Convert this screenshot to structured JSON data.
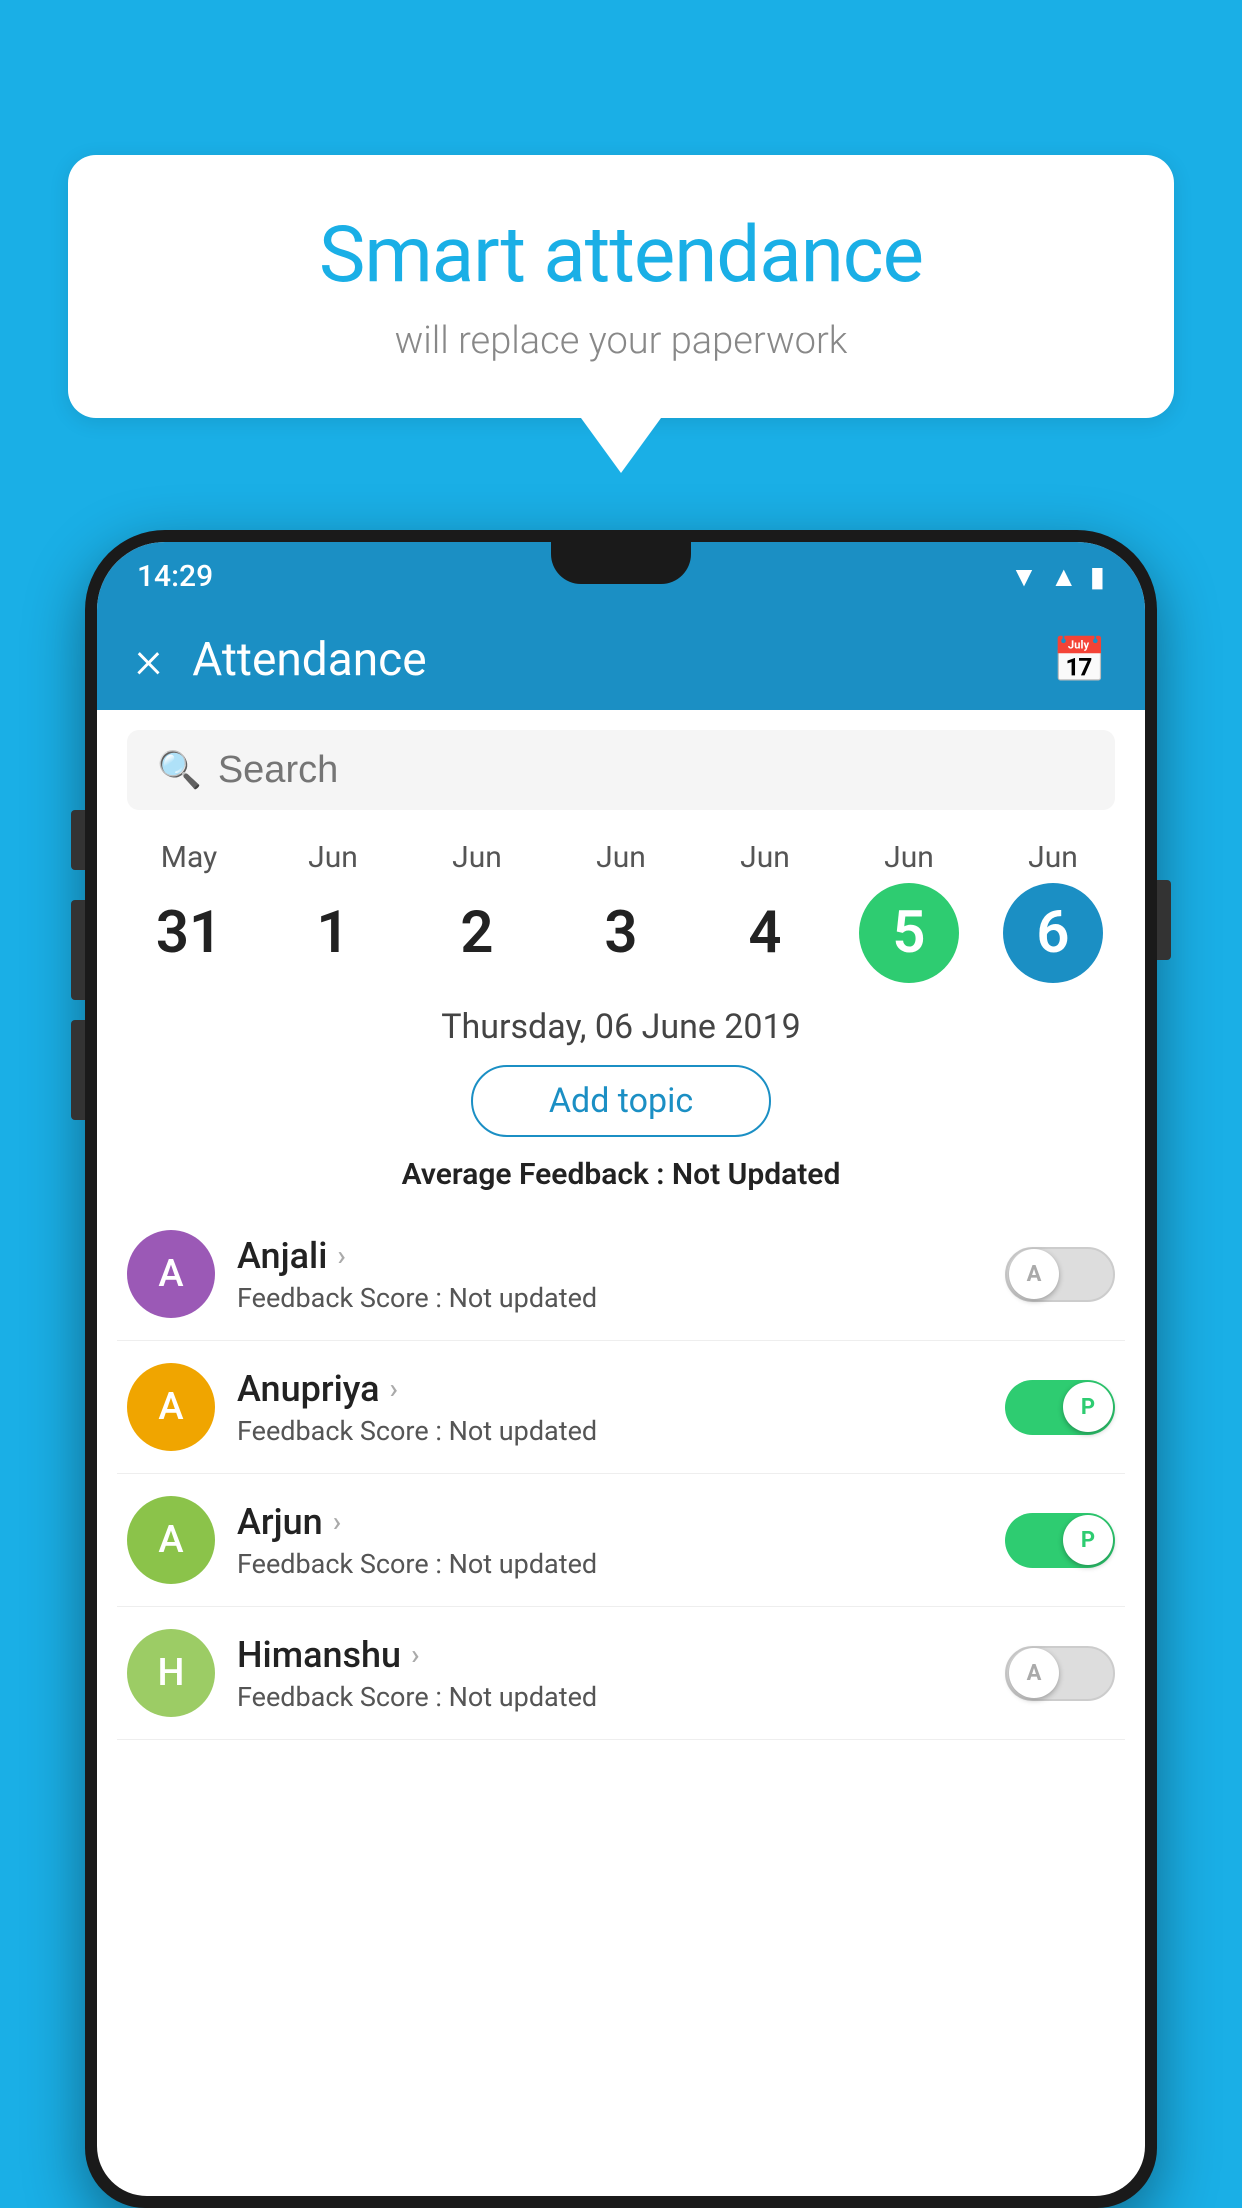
{
  "bubble": {
    "title": "Smart attendance",
    "subtitle": "will replace your paperwork"
  },
  "statusBar": {
    "time": "14:29"
  },
  "appBar": {
    "title": "Attendance",
    "closeLabel": "×"
  },
  "search": {
    "placeholder": "Search"
  },
  "calendar": {
    "days": [
      {
        "month": "May",
        "date": "31",
        "state": "normal"
      },
      {
        "month": "Jun",
        "date": "1",
        "state": "normal"
      },
      {
        "month": "Jun",
        "date": "2",
        "state": "normal"
      },
      {
        "month": "Jun",
        "date": "3",
        "state": "normal"
      },
      {
        "month": "Jun",
        "date": "4",
        "state": "normal"
      },
      {
        "month": "Jun",
        "date": "5",
        "state": "today"
      },
      {
        "month": "Jun",
        "date": "6",
        "state": "selected"
      }
    ],
    "selectedDate": "Thursday, 06 June 2019"
  },
  "addTopicBtn": "Add topic",
  "averageFeedback": {
    "label": "Average Feedback : ",
    "value": "Not Updated"
  },
  "students": [
    {
      "name": "Anjali",
      "avatarLetter": "A",
      "avatarColor": "#9B59B6",
      "feedbackLabel": "Feedback Score : ",
      "feedbackValue": "Not updated",
      "toggleState": "off",
      "toggleLetter": "A"
    },
    {
      "name": "Anupriya",
      "avatarLetter": "A",
      "avatarColor": "#F0A500",
      "feedbackLabel": "Feedback Score : ",
      "feedbackValue": "Not updated",
      "toggleState": "on",
      "toggleLetter": "P"
    },
    {
      "name": "Arjun",
      "avatarLetter": "A",
      "avatarColor": "#8BC34A",
      "feedbackLabel": "Feedback Score : ",
      "feedbackValue": "Not updated",
      "toggleState": "on",
      "toggleLetter": "P"
    },
    {
      "name": "Himanshu",
      "avatarLetter": "H",
      "avatarColor": "#9CCC65",
      "feedbackLabel": "Feedback Score : ",
      "feedbackValue": "Not updated",
      "toggleState": "off",
      "toggleLetter": "A"
    }
  ]
}
